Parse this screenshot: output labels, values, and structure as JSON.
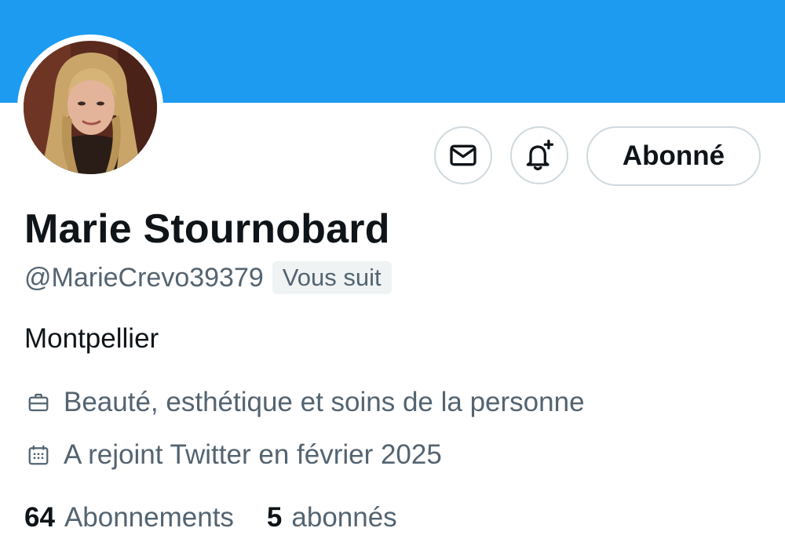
{
  "profile": {
    "display_name": "Marie Stournobard",
    "handle": "@MarieCrevo39379",
    "follows_you_badge": "Vous suit",
    "bio": "Montpellier",
    "category": "Beauté, esthétique et soins de la personne",
    "joined": "A rejoint Twitter en février 2025"
  },
  "actions": {
    "message_icon": "envelope-icon",
    "notify_icon": "bell-plus-icon",
    "follow_label": "Abonné"
  },
  "stats": {
    "following_count": "64",
    "following_label": "Abonnements",
    "followers_count": "5",
    "followers_label": "abonnés"
  },
  "colors": {
    "banner": "#1d9bf0",
    "text_primary": "#0f1419",
    "text_secondary": "#536471",
    "border": "#cfd9de",
    "badge_bg": "#eff3f4"
  }
}
